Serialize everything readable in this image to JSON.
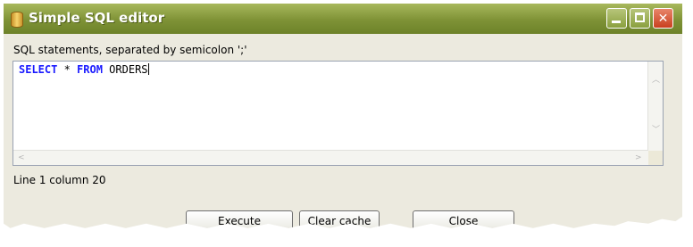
{
  "window": {
    "title": "Simple SQL editor",
    "controls": {
      "minimize": "",
      "maximize": "",
      "close": "✕"
    }
  },
  "editor": {
    "label": "SQL statements, separated by semicolon ';'",
    "tokens": [
      {
        "text": "SELECT",
        "kind": "keyword"
      },
      {
        "text": " * ",
        "kind": "plain"
      },
      {
        "text": "FROM",
        "kind": "keyword"
      },
      {
        "text": " ORDERS",
        "kind": "plain"
      }
    ],
    "status": "Line 1 column 20"
  },
  "buttons": {
    "execute": "Execute",
    "clear_cache": "Clear cache",
    "close": "Close"
  },
  "colors": {
    "titlebar": "#7e9236",
    "keyword": "#1a1aff",
    "close_button": "#c9401e"
  }
}
